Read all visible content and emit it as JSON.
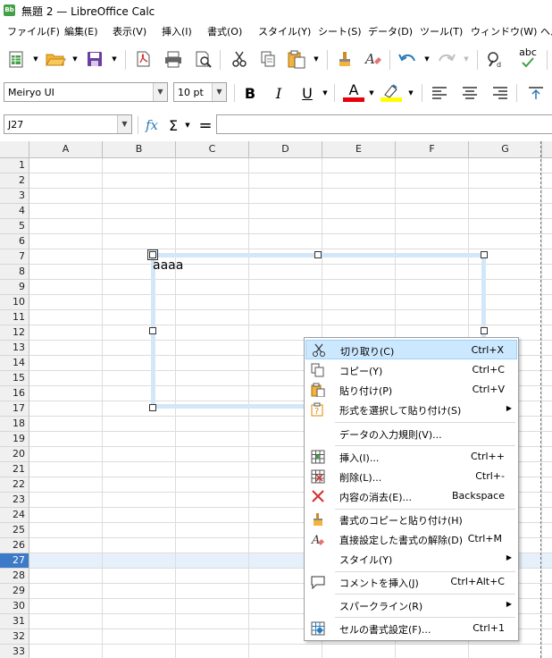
{
  "window": {
    "title": "無題 2 — LibreOffice Calc",
    "app_badge": "Bb"
  },
  "menubar": [
    "ファイル(F)",
    "編集(E)",
    "表示(V)",
    "挿入(I)",
    "書式(O)",
    "スタイル(Y)",
    "シート(S)",
    "データ(D)",
    "ツール(T)",
    "ウィンドウ(W)",
    "ヘル"
  ],
  "toolbar": {
    "font_name": "Meiryo UI",
    "font_size": "10 pt",
    "bold": "B",
    "italic": "I",
    "underline": "U",
    "font_color_glyph": "A",
    "font_color": "#e8000b",
    "highlight_color": "#ffff00",
    "spell_glyph": "abc"
  },
  "formula": {
    "name_box": "J27",
    "fx": "fx",
    "sum": "Σ",
    "equals": "=",
    "content": ""
  },
  "columns": [
    "A",
    "B",
    "C",
    "D",
    "E",
    "F",
    "G"
  ],
  "rows": [
    "1",
    "2",
    "3",
    "4",
    "5",
    "6",
    "7",
    "8",
    "9",
    "10",
    "11",
    "12",
    "13",
    "14",
    "15",
    "16",
    "17",
    "18",
    "19",
    "20",
    "21",
    "22",
    "23",
    "24",
    "25",
    "26",
    "27",
    "28",
    "29",
    "30",
    "31",
    "32",
    "33"
  ],
  "selected_row": "27",
  "shape": {
    "text": "aaaa"
  },
  "context_menu": [
    {
      "label": "切り取り(C)",
      "shortcut": "Ctrl+X",
      "icon": "scissors-icon",
      "highlighted": true
    },
    {
      "label": "コピー(Y)",
      "shortcut": "Ctrl+C",
      "icon": "copy-icon"
    },
    {
      "label": "貼り付け(P)",
      "shortcut": "Ctrl+V",
      "icon": "paste-icon"
    },
    {
      "label": "形式を選択して貼り付け(S)",
      "shortcut": "",
      "icon": "paste-special-icon",
      "submenu": true
    },
    {
      "label": "データの入力規則(V)...",
      "shortcut": "",
      "icon": ""
    },
    {
      "label": "挿入(I)...",
      "shortcut": "Ctrl++",
      "icon": "insert-cells-icon"
    },
    {
      "label": "削除(L)...",
      "shortcut": "Ctrl+-",
      "icon": "delete-cells-icon"
    },
    {
      "label": "内容の消去(E)...",
      "shortcut": "Backspace",
      "icon": "clear-contents-icon"
    },
    {
      "label": "書式のコピーと貼り付け(H)",
      "shortcut": "",
      "icon": "clone-formatting-icon"
    },
    {
      "label": "直接設定した書式の解除(D)",
      "shortcut": "Ctrl+M",
      "icon": "clear-formatting-icon"
    },
    {
      "label": "スタイル(Y)",
      "shortcut": "",
      "icon": "",
      "submenu": true
    },
    {
      "label": "コメントを挿入(J)",
      "shortcut": "Ctrl+Alt+C",
      "icon": "comment-icon"
    },
    {
      "label": "スパークライン(R)",
      "shortcut": "",
      "icon": "",
      "submenu": true
    },
    {
      "label": "セルの書式設定(F)...",
      "shortcut": "Ctrl+1",
      "icon": "format-cells-icon"
    }
  ]
}
